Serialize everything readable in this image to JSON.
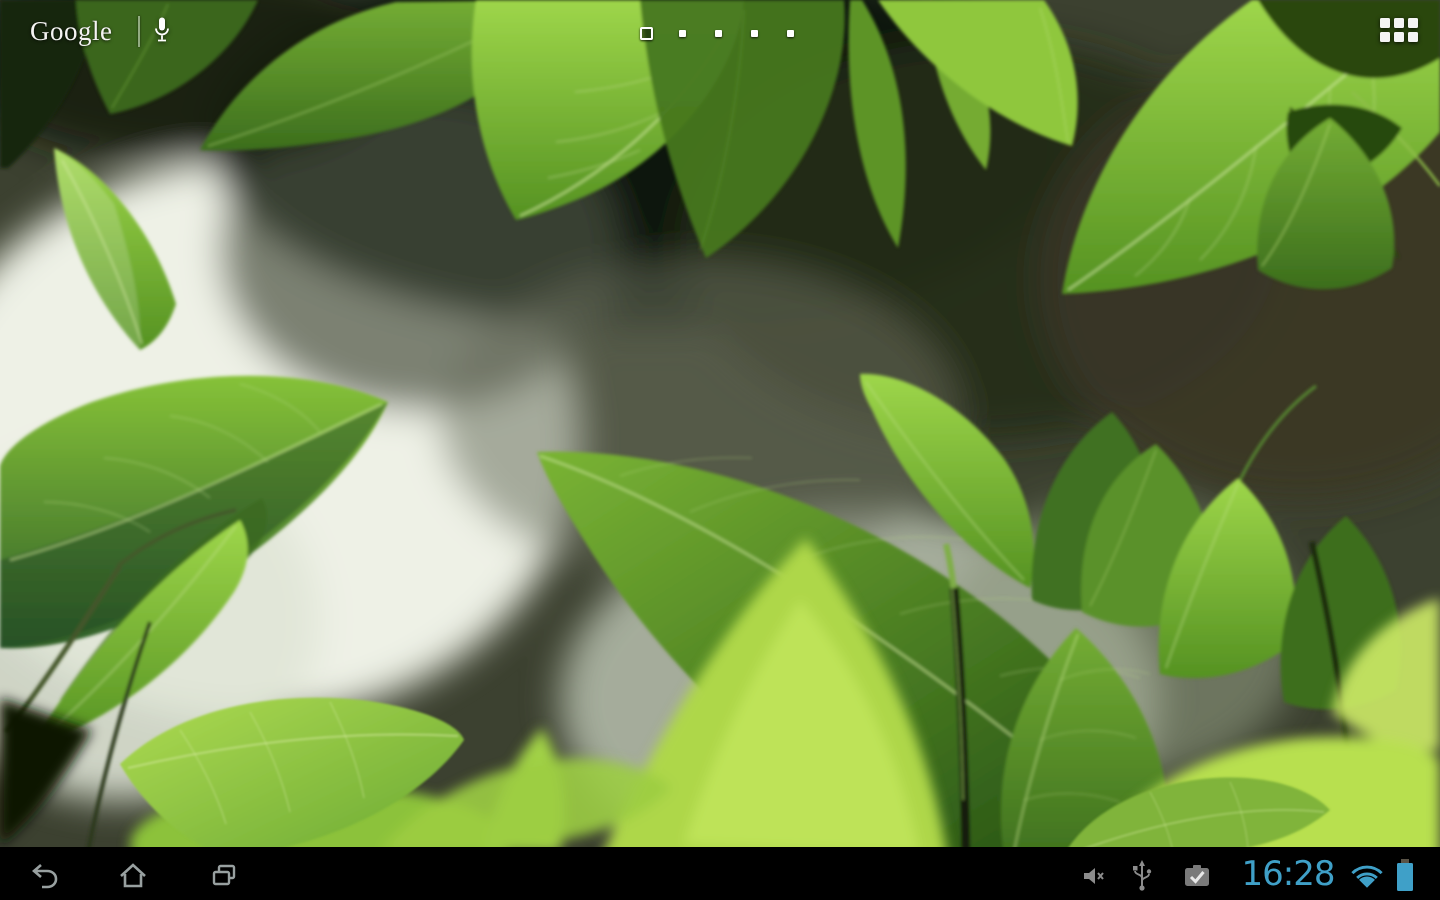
{
  "ui": {
    "search_widget": {
      "logo_text": "Google",
      "voice_icon": "microphone-icon"
    },
    "page_indicator": {
      "total_pages": 5,
      "current_page": 1
    },
    "all_apps_button": {
      "icon": "apps-grid-icon"
    },
    "system_bar": {
      "clock": "16:28",
      "nav_buttons": [
        {
          "name": "back",
          "icon": "back-icon"
        },
        {
          "name": "home",
          "icon": "home-icon"
        },
        {
          "name": "recents",
          "icon": "recents-icon"
        }
      ],
      "notification_icons": [
        "volume-muted-icon",
        "usb-connected-icon",
        "task-complete-icon"
      ],
      "status_icons": [
        "wifi-icon",
        "battery-full-icon"
      ],
      "colors": {
        "accent_blue": "#3fa0c8",
        "icon_gray": "#8c8c8c",
        "bar_background": "#000000"
      }
    },
    "wallpaper": {
      "subject": "green leaves live wallpaper",
      "dominant_colors": [
        "#8dc63f",
        "#3c6e1d",
        "#eef1e6",
        "#10150a"
      ]
    }
  }
}
